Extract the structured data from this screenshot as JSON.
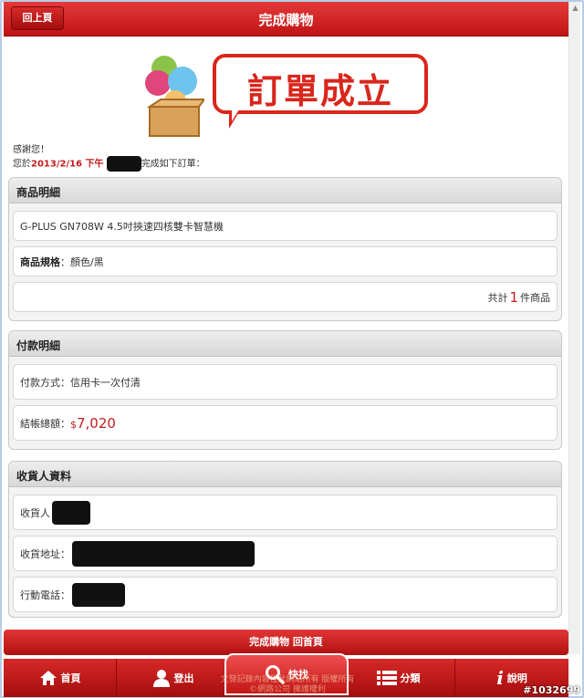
{
  "header": {
    "title": "完成購物",
    "back_label": "回上頁"
  },
  "banner": {
    "text": "訂單成立"
  },
  "thanks": {
    "line1": "感謝您！",
    "prefix": "您於",
    "date": "2013/2/16 下午",
    "suffix": "完成如下訂單："
  },
  "product": {
    "title": "商品明細",
    "name": "G-PLUS GN708W 4.5吋挾速四核雙卡智慧機",
    "spec_label": "商品規格",
    "spec_value": "：顏色/黑",
    "total_prefix": "共計",
    "total_count": "1",
    "total_suffix": "件商品"
  },
  "payment": {
    "title": "付款明細",
    "method": "付款方式：信用卡一次付清",
    "total_label": "結帳總額：",
    "currency": "$",
    "total_amount": "7,020"
  },
  "receiver": {
    "title": "收貨人資料",
    "name_label": "收貨人",
    "address_label": "收貨地址：",
    "phone_label": "行動電話："
  },
  "finish_button": "完成購物 回首頁",
  "nav": {
    "home": "首頁",
    "logout": "登出",
    "search": "快找",
    "category": "分類",
    "help": "說明"
  },
  "footer_text": "文發記錄內容僅此網站所有 版權所有 ©網路公司 擁護權利",
  "watermark": "#1032699"
}
